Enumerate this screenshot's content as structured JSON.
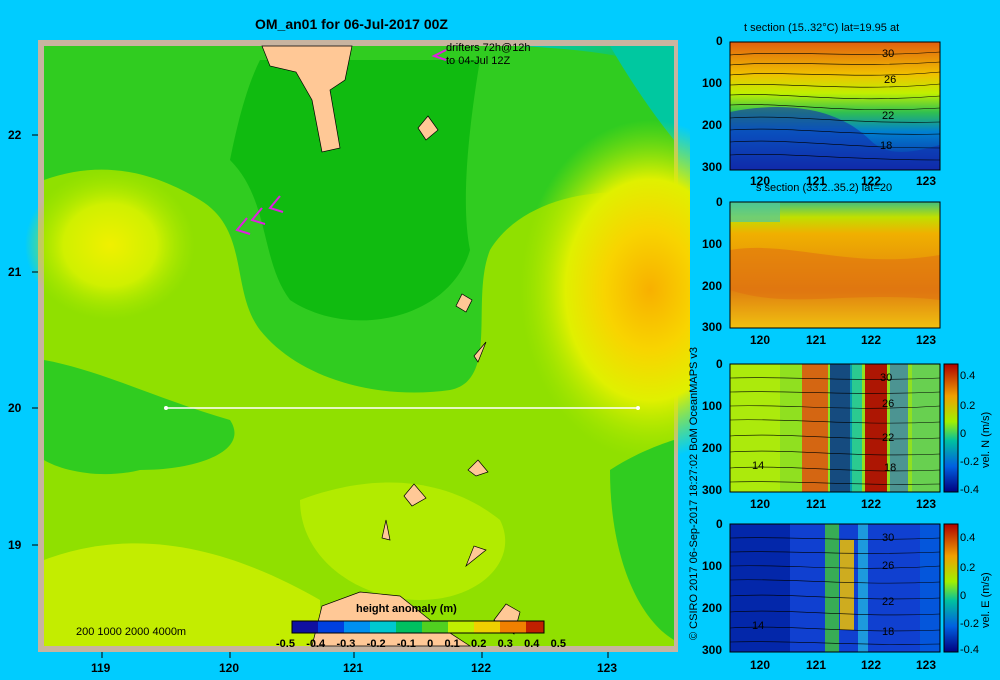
{
  "main_map": {
    "title": "OM_an01 for 06-Jul-2017 00Z",
    "drifter_note_line1": "drifters 72h@12h",
    "drifter_note_line2": "to 04-Jul 12Z",
    "lat_ticks": [
      "22",
      "21",
      "20",
      "19"
    ],
    "lon_ticks": [
      "119",
      "120",
      "121",
      "122",
      "123"
    ],
    "depth_legend": "200 1000 2000 4000m",
    "colorbar_label": "height anomaly  (m)",
    "colorbar_ticks": [
      "-0.5",
      "-0.4",
      "-0.3",
      "-0.2",
      "-0.1",
      "0",
      "0.1",
      "0.2",
      "0.3",
      "0.4",
      "0.5"
    ]
  },
  "side_panels": {
    "t_section_title": "t section (15..32°C) lat=19.95 at",
    "s_section_title": "s section (33.2..35.2) lat=20",
    "velN_label": "vel. N  (m/s)",
    "velE_label": "vel. E  (m/s)",
    "depth_ticks": [
      "0",
      "100",
      "200",
      "300"
    ],
    "lon_ticks": [
      "120",
      "121",
      "122",
      "123"
    ],
    "vel_ticks": [
      "0.4",
      "0.2",
      "0",
      "-0.2",
      "-0.4"
    ],
    "contour_labels_t": [
      "30",
      "26",
      "22",
      "18"
    ],
    "contour_labels_n": [
      "30",
      "26",
      "22",
      "18",
      "14"
    ],
    "contour_labels_e": [
      "30",
      "26",
      "22",
      "18",
      "14"
    ]
  },
  "credit": "© CSIRO 2017    06-Sep-2017 18:27:02 BoM OceanMAPS v3",
  "chart_data": [
    {
      "type": "heatmap",
      "title": "OM_an01 for 06-Jul-2017 00Z",
      "xlabel": "",
      "ylabel": "",
      "xlim": [
        118.5,
        123.5
      ],
      "ylim": [
        18.25,
        22.7
      ],
      "colorbar_label": "height anomaly  (m)",
      "colorbar_range": [
        -0.5,
        0.5
      ],
      "section_line": {
        "lat": 20,
        "lon": [
          119.5,
          123.2
        ]
      }
    },
    {
      "type": "heatmap",
      "title": "t section (15..32°C) lat=19.95 at",
      "xlim": [
        119.6,
        123.3
      ],
      "ylim": [
        300,
        0
      ],
      "contour_labels": [
        30,
        26,
        22,
        18
      ]
    },
    {
      "type": "heatmap",
      "title": "s section (33.2..35.2) lat=20",
      "xlim": [
        119.6,
        123.3
      ],
      "ylim": [
        300,
        0
      ]
    },
    {
      "type": "heatmap",
      "title": "",
      "xlim": [
        119.6,
        123.3
      ],
      "ylim": [
        300,
        0
      ],
      "colorbar_label": "vel. N  (m/s)",
      "colorbar_range": [
        -0.4,
        0.4
      ]
    },
    {
      "type": "heatmap",
      "title": "",
      "xlim": [
        119.6,
        123.3
      ],
      "ylim": [
        300,
        0
      ],
      "colorbar_label": "vel. E  (m/s)",
      "colorbar_range": [
        -0.4,
        0.4
      ]
    }
  ]
}
